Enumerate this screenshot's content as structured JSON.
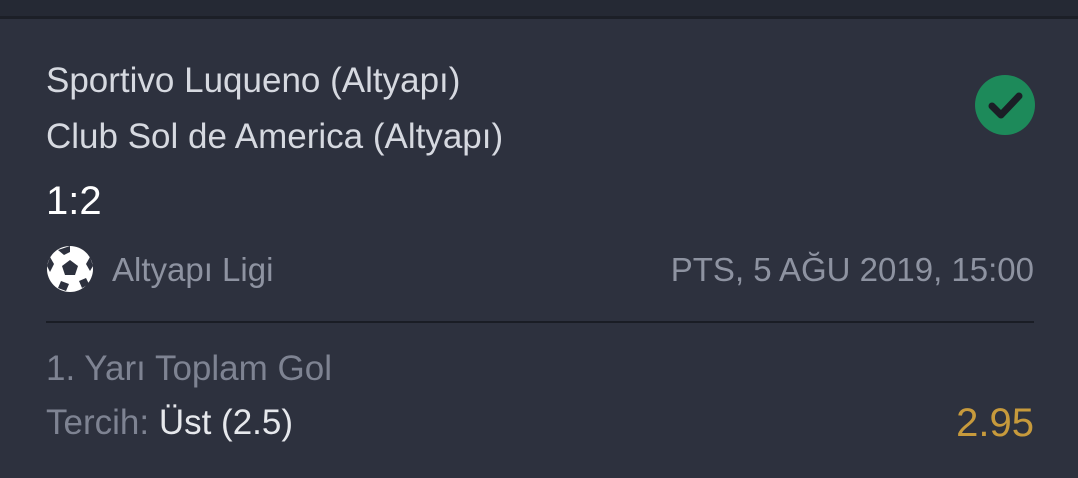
{
  "match": {
    "home_team": "Sportivo Luqueno (Altyapı)",
    "away_team": "Club Sol de America (Altyapı)",
    "score": "1:2",
    "status_icon": "check-circle-icon",
    "status_color": "#1d8a5a"
  },
  "league": {
    "sport_icon": "soccer-ball-icon",
    "name": "Altyapı Ligi",
    "date": "PTS, 5 AĞU 2019, 15:00"
  },
  "bet": {
    "market": "1. Yarı Toplam Gol",
    "selection_label": "Tercih: ",
    "selection_value": "Üst (2.5)",
    "odds": "2.95",
    "odds_color": "#c79a3c"
  }
}
